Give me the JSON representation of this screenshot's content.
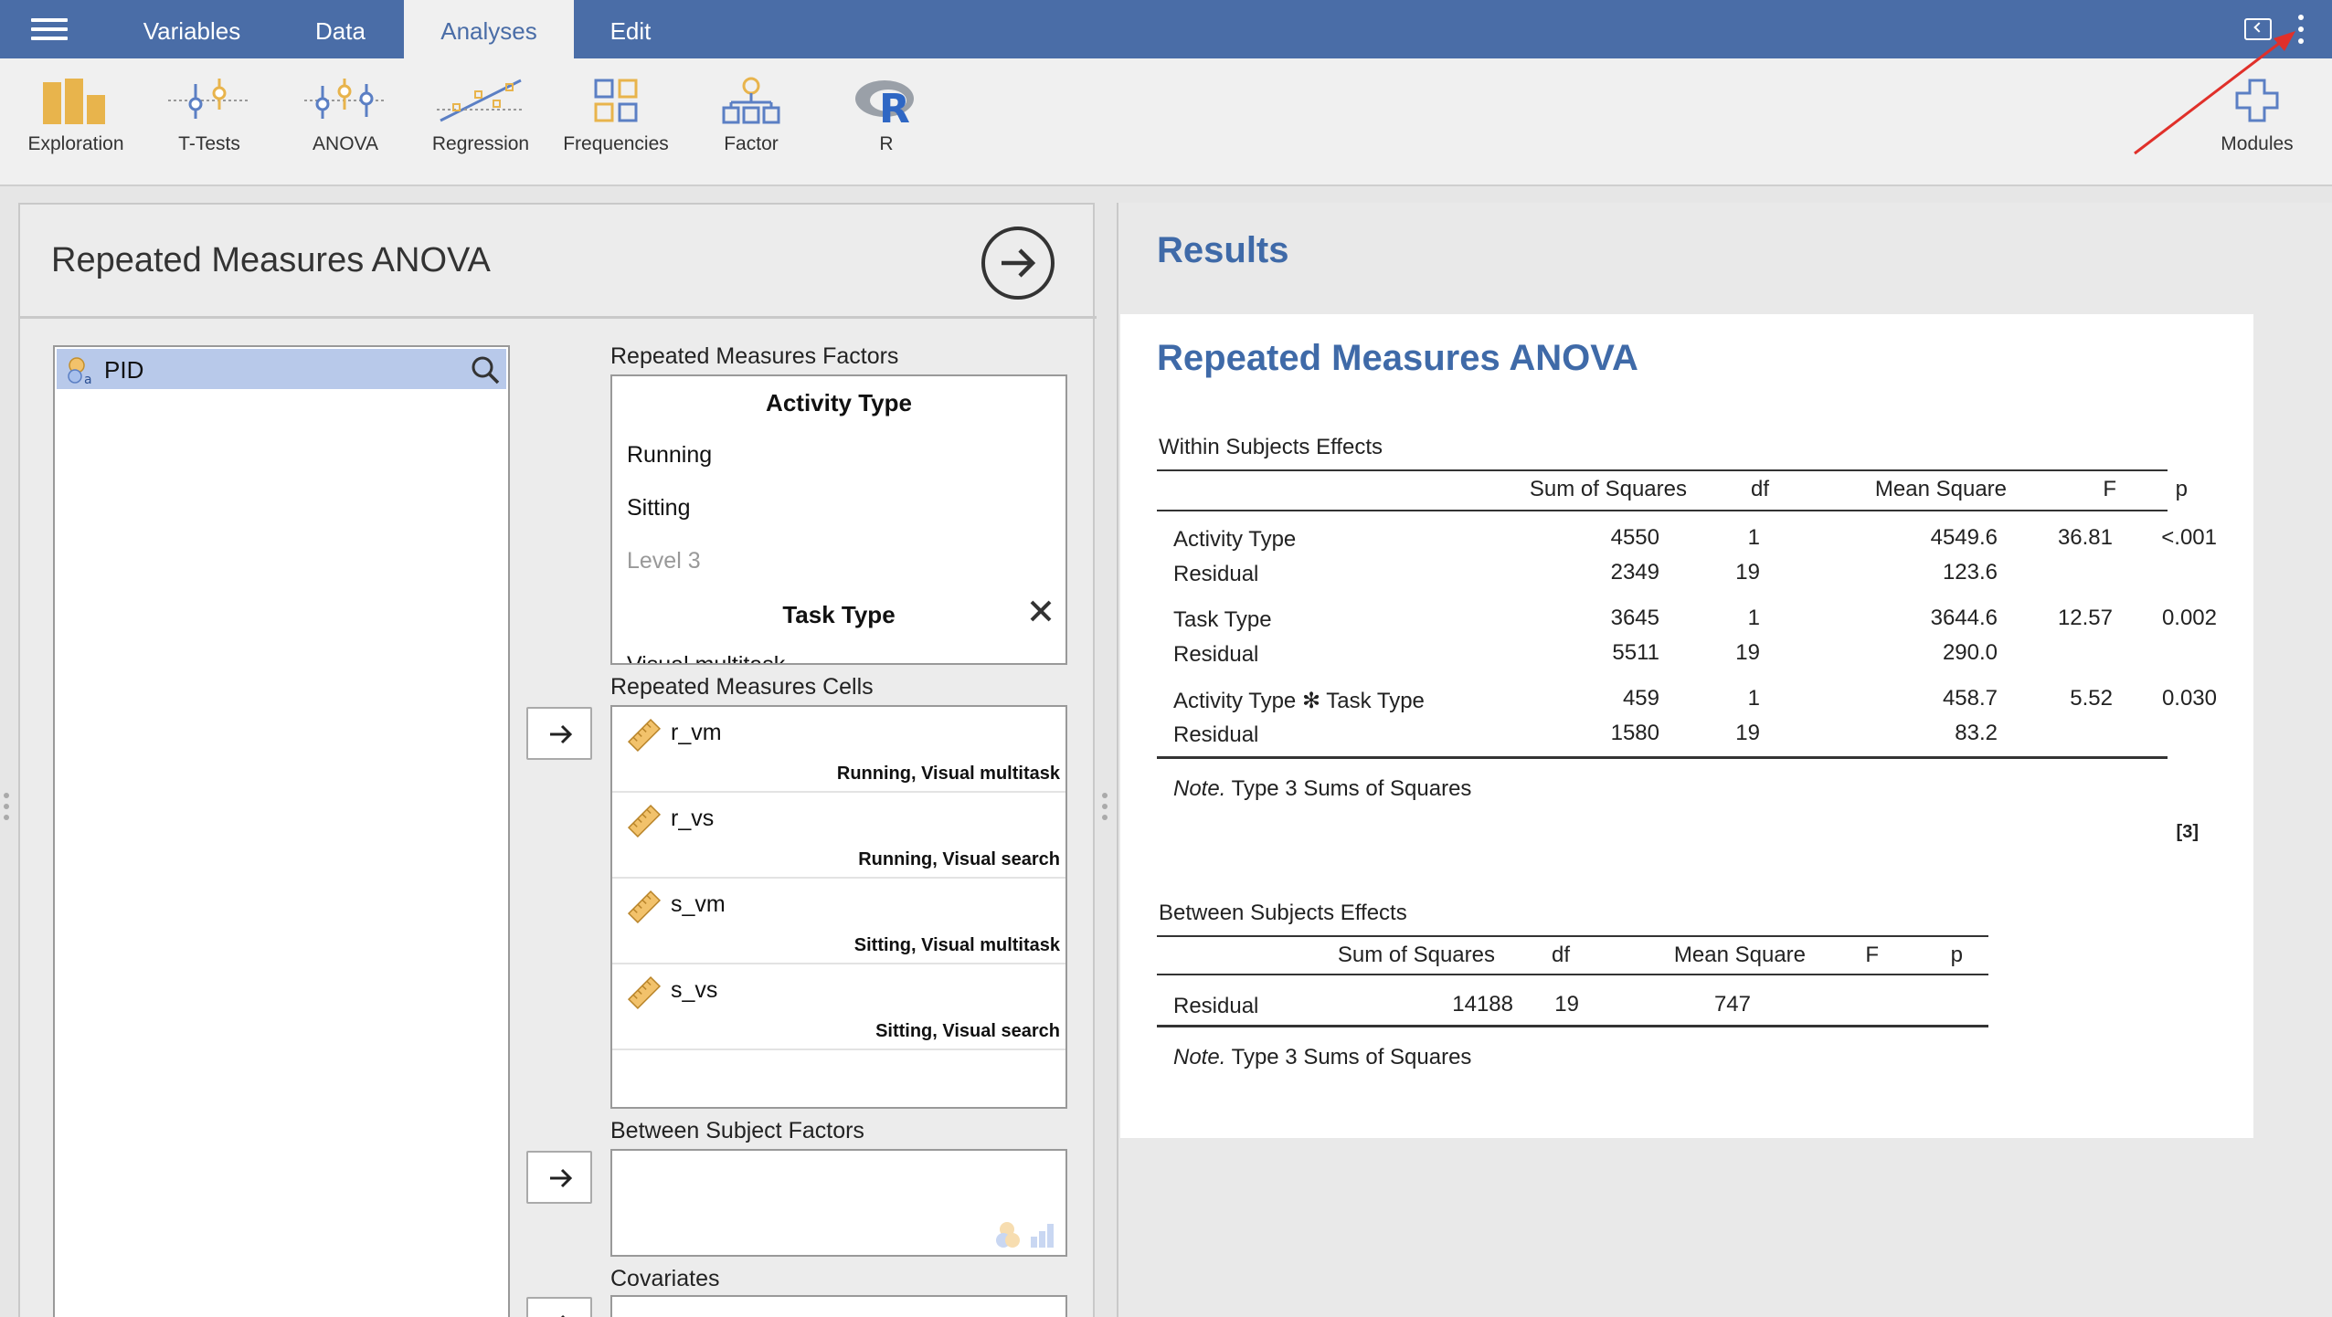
{
  "menu": {
    "tabs": [
      {
        "label": "Variables"
      },
      {
        "label": "Data"
      },
      {
        "label": "Analyses"
      },
      {
        "label": "Edit"
      }
    ]
  },
  "ribbon": {
    "items": [
      {
        "label": "Exploration",
        "icon": "exploration-icon"
      },
      {
        "label": "T-Tests",
        "icon": "t-tests-icon"
      },
      {
        "label": "ANOVA",
        "icon": "anova-icon"
      },
      {
        "label": "Regression",
        "icon": "regression-icon"
      },
      {
        "label": "Frequencies",
        "icon": "frequencies-icon"
      },
      {
        "label": "Factor",
        "icon": "factor-icon"
      },
      {
        "label": "R",
        "icon": "r-icon"
      }
    ],
    "modules_label": "Modules"
  },
  "options": {
    "title": "Repeated Measures ANOVA",
    "variables": [
      {
        "name": "PID"
      }
    ],
    "rm_factors_label": "Repeated Measures Factors",
    "rm_factors": {
      "factor1": "Activity Type",
      "levels1": [
        "Running",
        "Sitting"
      ],
      "placeholder_level": "Level 3",
      "factor2": "Task Type",
      "partial_level": "Visual multitask"
    },
    "rm_cells_label": "Repeated Measures Cells",
    "rm_cells": [
      {
        "name": "r_vm",
        "tag": "Running, Visual multitask"
      },
      {
        "name": "r_vs",
        "tag": "Running, Visual search"
      },
      {
        "name": "s_vm",
        "tag": "Sitting, Visual multitask"
      },
      {
        "name": "s_vs",
        "tag": "Sitting, Visual search"
      }
    ],
    "between_label": "Between Subject Factors",
    "covariates_label": "Covariates"
  },
  "results": {
    "heading": "Results",
    "anova_title": "Repeated Measures ANOVA",
    "within": {
      "caption": "Within Subjects Effects",
      "headers": [
        "Sum of Squares",
        "df",
        "Mean Square",
        "F",
        "p"
      ],
      "rows": [
        {
          "term": "Activity Type",
          "ss": "4550",
          "df": "1",
          "ms": "4549.6",
          "f": "36.81",
          "p": "<.001"
        },
        {
          "term": "Residual",
          "ss": "2349",
          "df": "19",
          "ms": "123.6",
          "f": "",
          "p": ""
        },
        {
          "term": "Task Type",
          "ss": "3645",
          "df": "1",
          "ms": "3644.6",
          "f": "12.57",
          "p": "0.002"
        },
        {
          "term": "Residual",
          "ss": "5511",
          "df": "19",
          "ms": "290.0",
          "f": "",
          "p": ""
        },
        {
          "term": "Activity Type ✻ Task Type",
          "ss": "459",
          "df": "1",
          "ms": "458.7",
          "f": "5.52",
          "p": "0.030"
        },
        {
          "term": "Residual",
          "ss": "1580",
          "df": "19",
          "ms": "83.2",
          "f": "",
          "p": ""
        }
      ],
      "note_label": "Note.",
      "note_text": "Type 3 Sums of Squares",
      "reference": "[3]"
    },
    "between": {
      "caption": "Between Subjects Effects",
      "headers": [
        "Sum of Squares",
        "df",
        "Mean Square",
        "F",
        "p"
      ],
      "rows": [
        {
          "term": "Residual",
          "ss": "14188",
          "df": "19",
          "ms": "747",
          "f": "",
          "p": ""
        }
      ],
      "note_label": "Note.",
      "note_text": "Type 3 Sums of Squares"
    }
  },
  "colors": {
    "menubar": "#4a6da7",
    "accent": "#3f6aa8",
    "selected": "#b8c9ea",
    "annotation_arrow": "#e0302a"
  }
}
